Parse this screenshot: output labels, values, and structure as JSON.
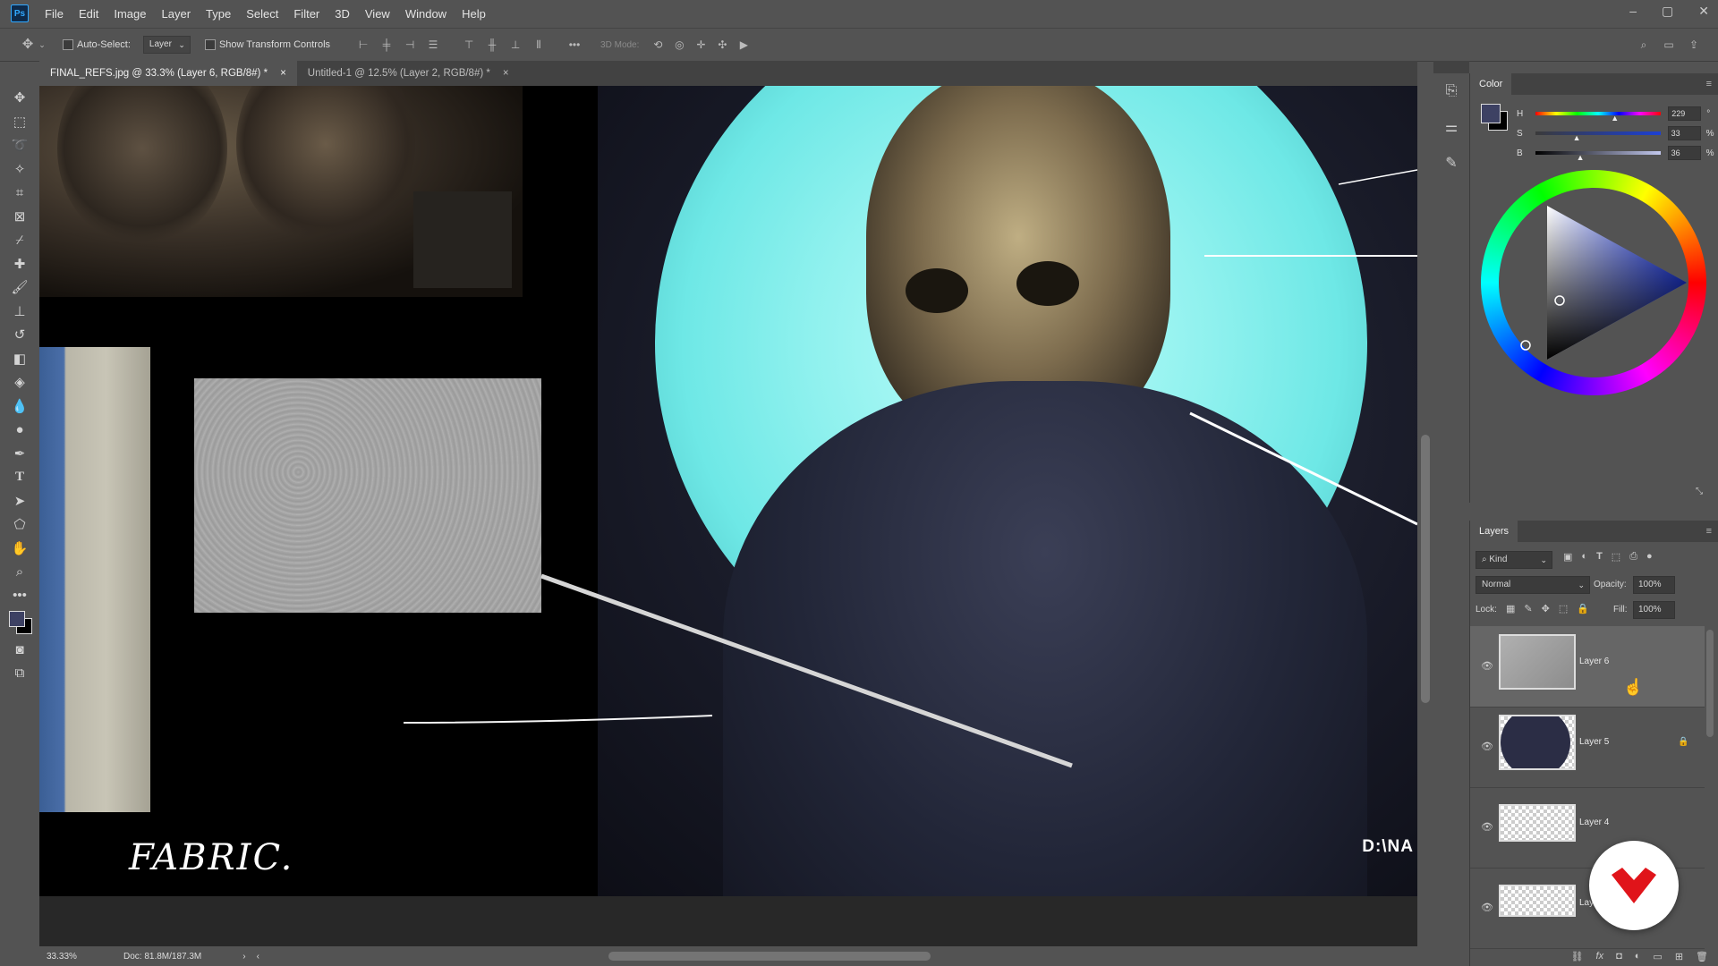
{
  "app": {
    "logo": "Ps"
  },
  "menu": [
    "File",
    "Edit",
    "Image",
    "Layer",
    "Type",
    "Select",
    "Filter",
    "3D",
    "View",
    "Window",
    "Help"
  ],
  "options": {
    "auto_select_label": "Auto-Select:",
    "auto_select_value": "Layer",
    "transform_label": "Show Transform Controls",
    "mode_3d": "3D Mode:"
  },
  "tabs": [
    {
      "label": "FINAL_REFS.jpg @ 33.3% (Layer 6, RGB/8#) *",
      "close": "×"
    },
    {
      "label": "Untitled-1 @ 12.5% (Layer 2, RGB/8#) *",
      "close": "×"
    }
  ],
  "canvas": {
    "annotation": "FABRIC.",
    "watermark": "D:\\NA"
  },
  "status": {
    "zoom": "33.33%",
    "doc": "Doc: 81.8M/187.3M"
  },
  "color_panel": {
    "title": "Color",
    "h_label": "H",
    "h_value": "229",
    "h_unit": "°",
    "s_label": "S",
    "s_value": "33",
    "s_unit": "%",
    "b_label": "B",
    "b_value": "36",
    "b_unit": "%",
    "fg_color": "#3d4163",
    "bg_color": "#000000"
  },
  "layers_panel": {
    "title": "Layers",
    "filter_kind": "Kind",
    "blend_mode": "Normal",
    "opacity_label": "Opacity:",
    "opacity_value": "100%",
    "lock_label": "Lock:",
    "fill_label": "Fill:",
    "fill_value": "100%",
    "layers": [
      {
        "name": "Layer 6",
        "selected": true
      },
      {
        "name": "Layer 5",
        "locked": true
      },
      {
        "name": "Layer 4"
      },
      {
        "name": "Layer 3"
      }
    ]
  },
  "colors": {
    "accent": "#31a8ff",
    "glow": "#6ee8e6",
    "badge": "#e0141a"
  }
}
